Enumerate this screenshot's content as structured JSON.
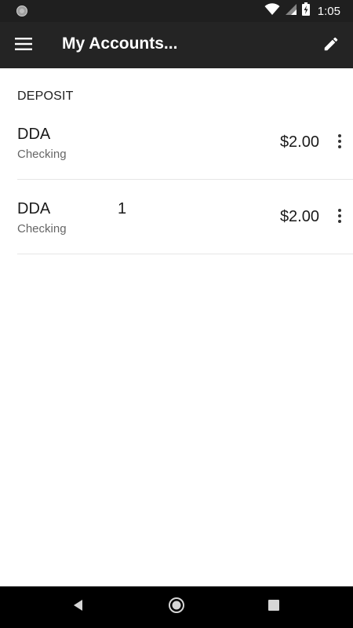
{
  "status_bar": {
    "time": "1:05",
    "icons": [
      "notification-circle-icon",
      "wifi-icon",
      "cell-signal-icon",
      "battery-charging-icon"
    ]
  },
  "app_bar": {
    "title": "My Accounts...",
    "menu_icon": "hamburger-menu-icon",
    "edit_icon": "pencil-icon"
  },
  "accounts": {
    "section_title": "DEPOSIT",
    "items": [
      {
        "name": "DDA",
        "number": "",
        "type": "Checking",
        "balance": "$2.00"
      },
      {
        "name": "DDA",
        "number": "1",
        "type": "Checking",
        "balance": "$2.00"
      }
    ]
  },
  "nav_bar": {
    "icons": [
      "back-icon",
      "home-icon",
      "recents-icon"
    ]
  },
  "colors": {
    "status_bar": "#1f1f1f",
    "app_bar": "#242424",
    "nav_bar": "#000000",
    "divider": "#e6e6e6",
    "secondary_text": "#666666"
  }
}
